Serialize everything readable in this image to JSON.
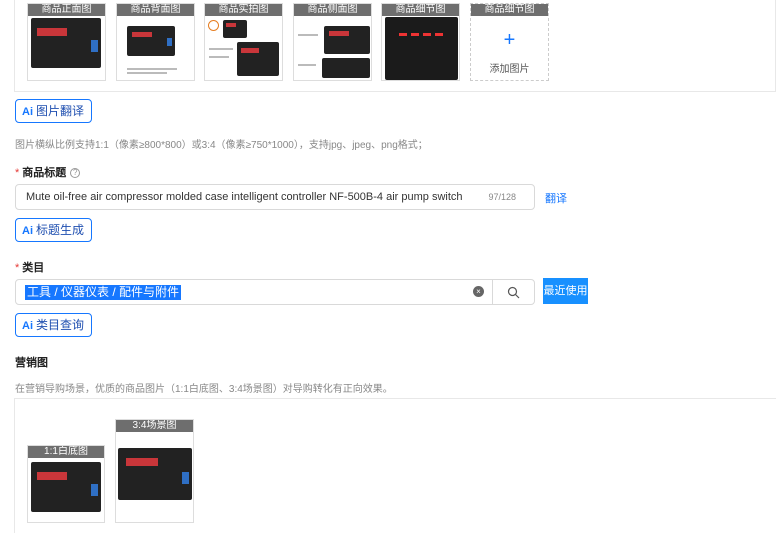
{
  "gallery": {
    "thumbs": [
      {
        "caption": "商品正面图"
      },
      {
        "caption": "商品背面图"
      },
      {
        "caption": "商品实拍图"
      },
      {
        "caption": "商品侧面图"
      },
      {
        "caption": "商品细节图"
      },
      {
        "caption": "商品细节图"
      }
    ],
    "add_label": "添加图片",
    "add_symbol": "+"
  },
  "image_translate": {
    "ai": "Ai",
    "label": "图片翻译"
  },
  "image_hint": "图片横纵比例支持1:1（像素≥800*800）或3:4（像素≥750*1000），支持jpg、jpeg、png格式；",
  "title_field": {
    "required_mark": "*",
    "label": "商品标题",
    "help_icon": "?",
    "value": "Mute oil-free air compressor molded case intelligent controller NF-500B-4 air pump switch",
    "counter": "97/128",
    "translate_link": "翻译"
  },
  "title_generate": {
    "ai": "Ai",
    "label": "标题生成"
  },
  "category_field": {
    "required_mark": "*",
    "label": "类目",
    "value": "工具 / 仪器仪表 / 配件与附件",
    "clear_icon": "×",
    "recent_label": "最近使用"
  },
  "category_query": {
    "ai": "Ai",
    "label": "类目查询"
  },
  "marketing": {
    "label": "营销图",
    "hint": "在营销导购场景，优质的商品图片（1:1白底图、3:4场景图）对导购转化有正向效果。",
    "images": [
      {
        "caption": "1:1白底图"
      },
      {
        "caption": "3:4场景图"
      }
    ]
  },
  "colors": {
    "accent": "#1677ff",
    "required": "#e53935",
    "device_screen": "#c9363a"
  }
}
